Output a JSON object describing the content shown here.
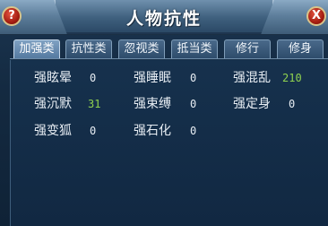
{
  "window": {
    "title": "人物抗性",
    "help_label": "?",
    "close_label": "X"
  },
  "tabs": [
    {
      "label": "加强类",
      "active": true
    },
    {
      "label": "抗性类",
      "active": false
    },
    {
      "label": "忽视类",
      "active": false
    },
    {
      "label": "抵当类",
      "active": false
    },
    {
      "label": "修行",
      "active": false
    },
    {
      "label": "修身",
      "active": false
    }
  ],
  "stats": [
    {
      "label": "强眩晕",
      "value": "0"
    },
    {
      "label": "强睡眠",
      "value": "0"
    },
    {
      "label": "强混乱",
      "value": "210"
    },
    {
      "label": "强沉默",
      "value": "31"
    },
    {
      "label": "强束缚",
      "value": "0"
    },
    {
      "label": "强定身",
      "value": "0"
    },
    {
      "label": "强变狐",
      "value": "0"
    },
    {
      "label": "强石化",
      "value": "0"
    }
  ],
  "colors": {
    "zero_value": "#e7edf3",
    "positive_value": "#8fd14f",
    "active_tab": "#6a8eb2"
  }
}
